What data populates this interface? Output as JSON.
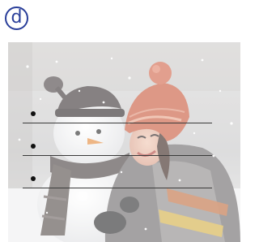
{
  "exercise": {
    "label": "d"
  },
  "photo": {
    "subject": "woman-hugging-snowman-photo"
  },
  "answer_lines": [
    {
      "value": ""
    },
    {
      "value": ""
    },
    {
      "value": ""
    }
  ],
  "colors": {
    "badge": "#2a3f9a",
    "answer_line": "#3a3a3a",
    "bullet": "#111111"
  }
}
